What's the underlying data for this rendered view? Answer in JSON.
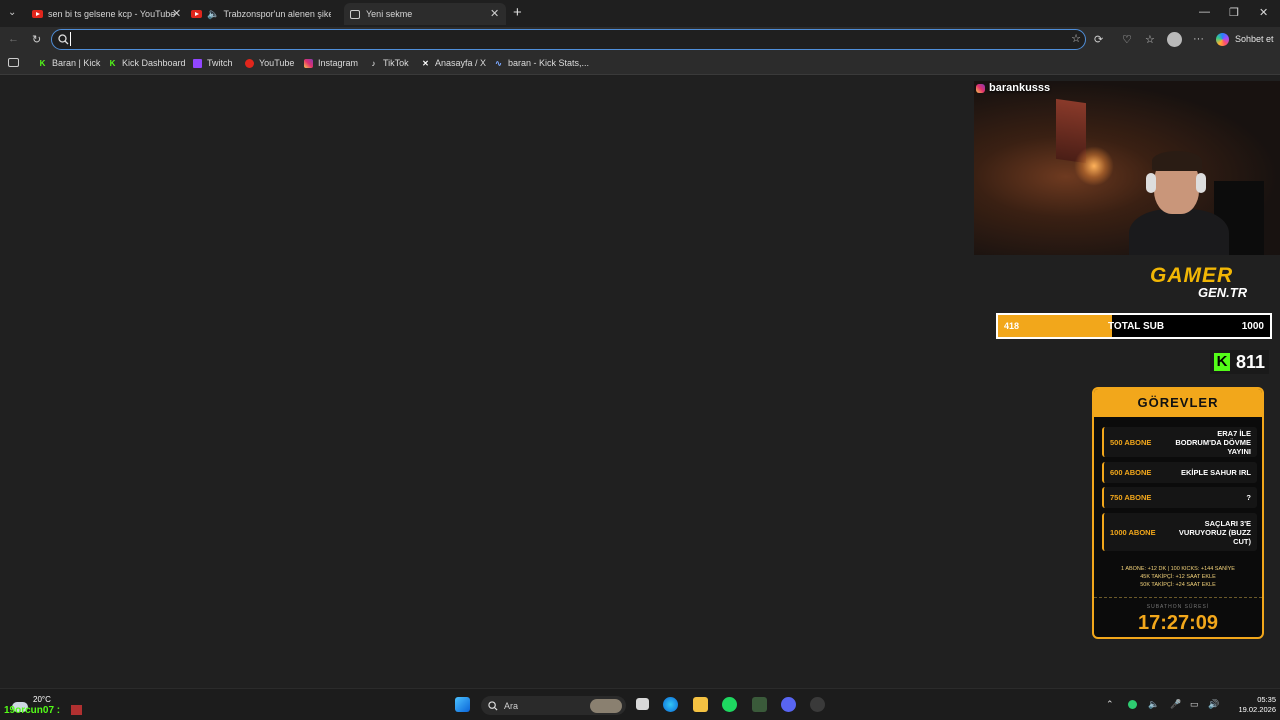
{
  "browser": {
    "tabs": [
      {
        "title": "sen bi ts gelsene kcp - YouTube",
        "favicon": "youtube-icon"
      },
      {
        "title": "Trabzonspor'un alenen şikesi",
        "favicon": "youtube-icon",
        "audio": "speaker-icon"
      },
      {
        "title": "Yeni sekme",
        "favicon": "page-icon",
        "active": true
      }
    ],
    "new_tab": "+",
    "address": {
      "value": "",
      "placeholder": ""
    },
    "copilot_label": "Sohbet et",
    "bookmarks": [
      {
        "label": "Baran | Kick",
        "icon": "kick-icon"
      },
      {
        "label": "Kick Dashboard",
        "icon": "kick-icon"
      },
      {
        "label": "Twitch",
        "icon": "twitch-icon"
      },
      {
        "label": "YouTube",
        "icon": "youtube-icon"
      },
      {
        "label": "Instagram",
        "icon": "instagram-icon"
      },
      {
        "label": "TikTok",
        "icon": "tiktok-icon"
      },
      {
        "label": "Anasayfa / X",
        "icon": "x-icon"
      },
      {
        "label": "baran - Kick Stats,...",
        "icon": "stats-icon"
      }
    ]
  },
  "overlay": {
    "webcam_name": "barankusss",
    "logo_main": "GAMER",
    "logo_sub": "GEN.TR",
    "sub_goal": {
      "current": "418",
      "label": "TOTAL SUB",
      "goal": "1000",
      "progress": 0.418
    },
    "kick_followers": "811",
    "tasks_title": "GÖREVLER",
    "tasks": [
      {
        "amount": "500 ABONE",
        "text": "ERA7 İLE BODRUM'DA DÖVME YAYINI"
      },
      {
        "amount": "600 ABONE",
        "text": "EKİPLE SAHUR IRL"
      },
      {
        "amount": "750 ABONE",
        "text": "?"
      },
      {
        "amount": "1000 ABONE",
        "text": "SAÇLARI 3'E VURUYORUZ (BUZZ CUT)"
      }
    ],
    "rules": [
      "1 ABONE: +12 DK  |  100 KICKS: +144 SANİYE",
      "45K TAKİPÇİ: +12 SAAT EKLE",
      "50K TAKİPÇİ: +24 SAAT EKLE"
    ],
    "timer_label": "SUBATHON SÜRESİ",
    "timer": "17:27:09",
    "chat_name": "19orcun07 :"
  },
  "taskbar": {
    "temperature": "20°C",
    "search_label": "Ara",
    "time": "05:35",
    "date": "19.02.2026"
  },
  "colors": {
    "accent": "#f2a71b",
    "kick": "#53fc18",
    "address_border": "#4f8ed8"
  }
}
